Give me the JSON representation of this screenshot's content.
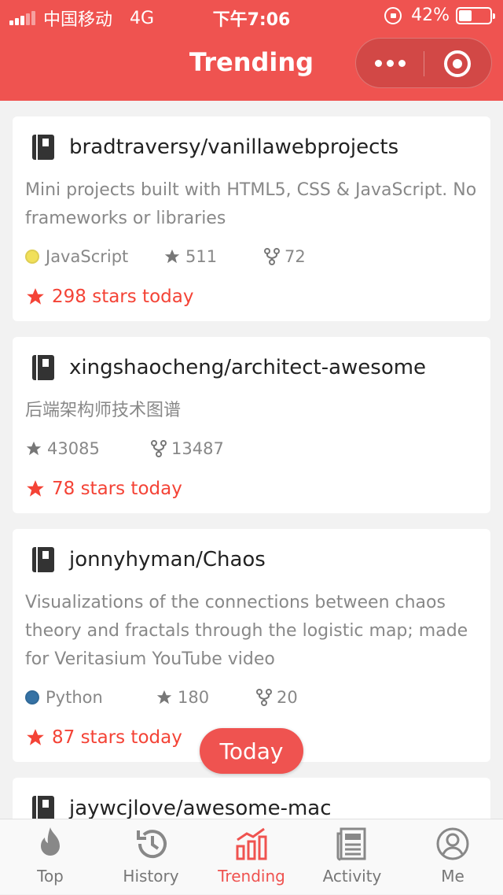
{
  "status": {
    "carrier": "中国移动",
    "network": "4G",
    "time": "下午7:06",
    "battery_text": "42%",
    "battery_level": 0.42
  },
  "nav": {
    "title": "Trending"
  },
  "repos": [
    {
      "name": "bradtraversy/vanillawebprojects",
      "desc": "Mini projects built with HTML5, CSS & JavaScript. No frameworks or libraries",
      "language": "JavaScript",
      "language_color": "#f1e05a",
      "stars": "511",
      "forks": "72",
      "today": "298 stars today"
    },
    {
      "name": "xingshaocheng/architect-awesome",
      "desc": "后端架构师技术图谱",
      "language": "",
      "language_color": "",
      "stars": "43085",
      "forks": "13487",
      "today": "78 stars today"
    },
    {
      "name": "jonnyhyman/Chaos",
      "desc": "Visualizations of the connections between chaos theory and fractals through the logistic map; made for Veritasium YouTube video",
      "language": "Python",
      "language_color": "#3572A5",
      "stars": "180",
      "forks": "20",
      "today": "87 stars today"
    },
    {
      "name": "jaywcjlove/awesome-mac"
    }
  ],
  "floating": {
    "today_label": "Today"
  },
  "tabs": [
    {
      "label": "Top",
      "icon": "fire-icon"
    },
    {
      "label": "History",
      "icon": "history-icon"
    },
    {
      "label": "Trending",
      "icon": "bar-chart-icon"
    },
    {
      "label": "Activity",
      "icon": "newspaper-icon"
    },
    {
      "label": "Me",
      "icon": "user-icon"
    }
  ],
  "colors": {
    "accent": "#ef5350",
    "today_red": "#f44336"
  }
}
